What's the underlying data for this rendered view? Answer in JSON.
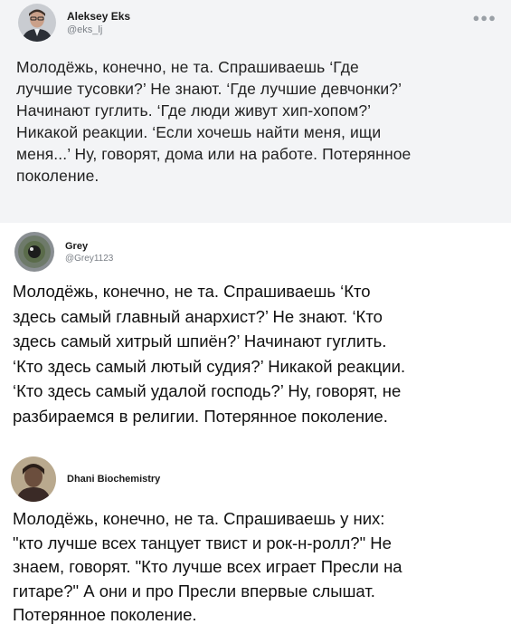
{
  "posts": [
    {
      "author": "Aleksey Eks",
      "handle": "@eks_lj",
      "more_icon": "more-dots-icon",
      "text": "Молодёжь, конечно, не та. Спрашиваешь ‘Где\nлучшие тусовки?’ Не знают. ‘Где лучшие девчонки?’\nНачинают гуглить. ‘Где люди живут хип-хопом?’\nНикакой реакции. ‘Если хочешь найти меня, ищи\nменя...’ Ну, говорят, дома или на работе. Потерянное\nпоколение."
    },
    {
      "author": "Grey",
      "handle": "@Grey1123",
      "text": "Молодёжь, конечно, не та. Спрашиваешь ‘Кто\nздесь самый главный анархист?’ Не знают. ‘Кто\nздесь самый хитрый шпиён?’ Начинают гуглить.\n‘Кто здесь самый лютый судия?’ Никакой реакции.\n‘Кто здесь самый удалой господь?’ Ну, говорят, не\nразбираемся в религии. Потерянное поколение."
    },
    {
      "author": "Dhani Biochemistry",
      "text": "Молодёжь, конечно, не та. Спрашиваешь у них:\n\"кто лучше всех танцует твист и рок-н-ролл?\" Не\nзнаем, говорят. \"Кто лучше всех играет Пресли на\nгитаре?\" А они и про Пресли впервые слышат.\nПотерянное поколение."
    }
  ]
}
